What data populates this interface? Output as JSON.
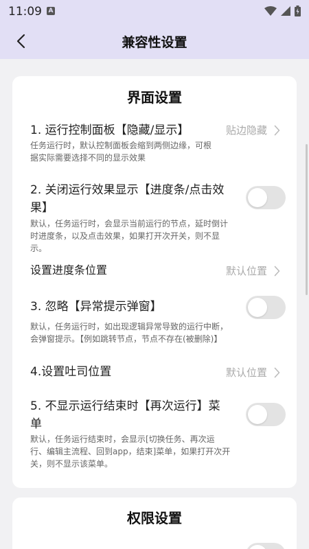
{
  "status": {
    "time": "11:09",
    "notif_icon": "A"
  },
  "header": {
    "title": "兼容性设置"
  },
  "section1": {
    "title": "界面设置",
    "items": [
      {
        "title": "1. 运行控制面板【隐藏/显示】",
        "value": "贴边隐藏",
        "desc_lines": [
          "任务运行时，默认控制面板会缩到两侧边缘，可根",
          "据实际需要选择不同的显示效果"
        ]
      },
      {
        "title_lines": [
          "2. 关闭运行效果显示【进度条/点击效",
          "果】"
        ],
        "toggle": false,
        "desc_lines": [
          "默认，任务运行时，会显示当前运行的节点，延时倒计",
          "时进度条，以及点击效果，如果打开次开关，则不显",
          "示。"
        ]
      },
      {
        "title": "设置进度条位置",
        "value": "默认位置"
      },
      {
        "title": "3. 忽略【异常提示弹窗】",
        "toggle": false,
        "desc_lines": [
          "默认，任务运行时，如出现逻辑异常导致的运行中断，",
          "会弹窗提示。【例如跳转节点，节点不存在(被删除)】"
        ]
      },
      {
        "title": "4.设置吐司位置",
        "value": "默认位置"
      },
      {
        "title_lines": [
          "5. 不显示运行结束时【再次运行】菜",
          "单"
        ],
        "toggle": false,
        "desc_lines": [
          "默认，任务运行结束时，会显示[切换任务、再次运",
          "行、编辑主流程、回到app，结束]菜单，如果打开次开",
          "关，则不显示该菜单。"
        ]
      }
    ]
  },
  "section2": {
    "title": "权限设置"
  }
}
